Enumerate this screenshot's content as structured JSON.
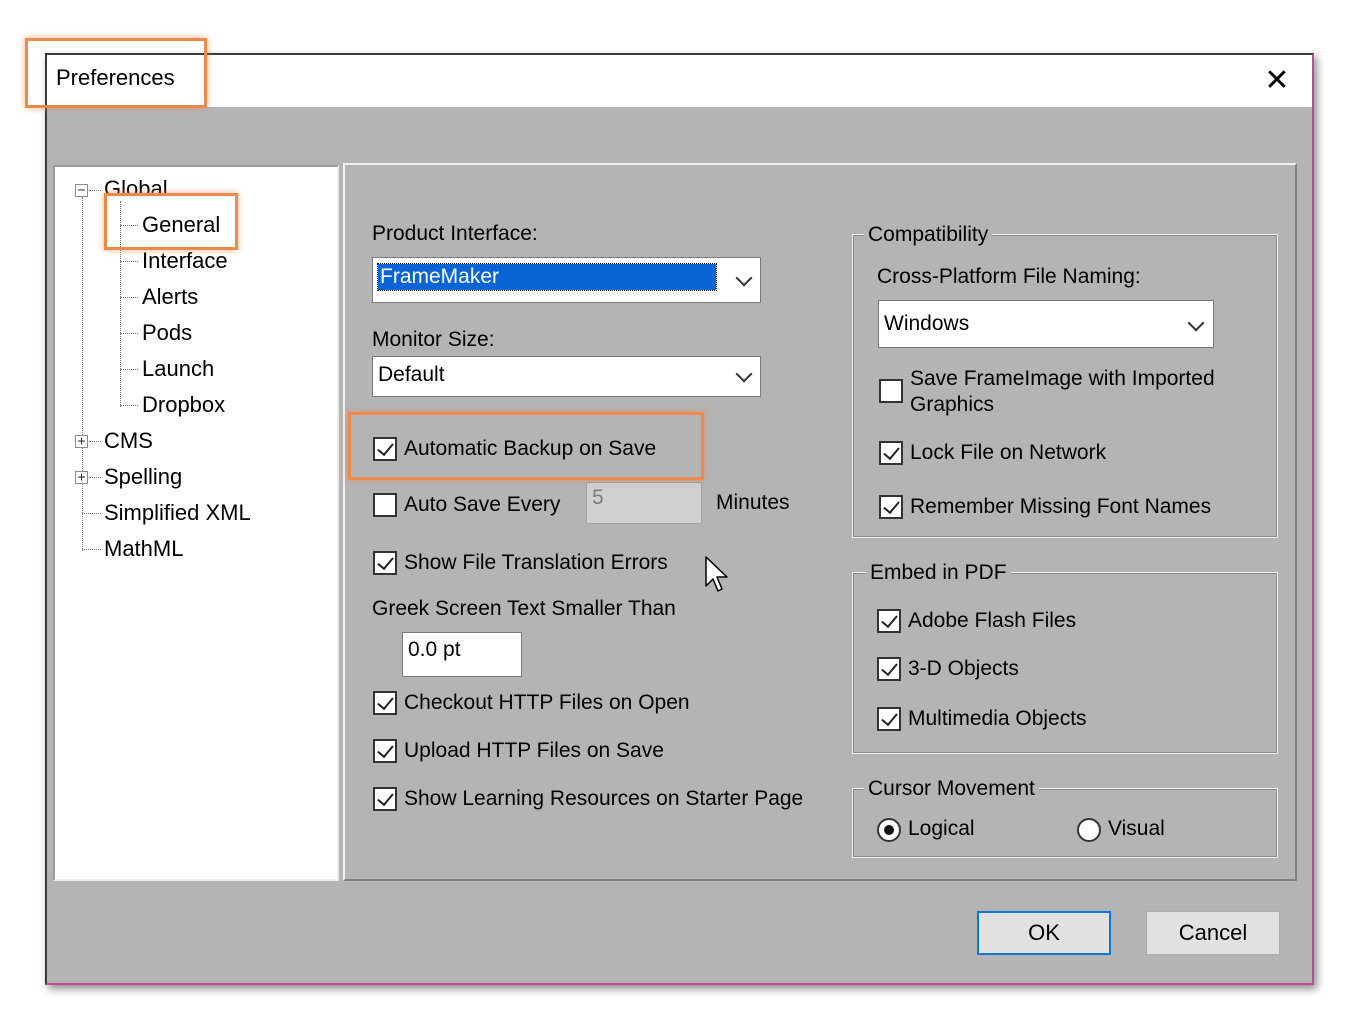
{
  "window": {
    "title": "Preferences",
    "close_glyph": "✕"
  },
  "tree": {
    "global": "Global",
    "children": [
      "General",
      "Interface",
      "Alerts",
      "Pods",
      "Launch",
      "Dropbox"
    ],
    "cms": "CMS",
    "spelling": "Spelling",
    "simplified_xml": "Simplified XML",
    "mathml": "MathML",
    "collapse_glyph": "−",
    "expand_glyph": "+"
  },
  "general": {
    "product_interface_label": "Product Interface:",
    "product_interface_value": "FrameMaker",
    "monitor_size_label": "Monitor Size:",
    "monitor_size_value": "Default",
    "automatic_backup_label": "Automatic Backup on Save",
    "automatic_backup_checked": true,
    "auto_save_label": "Auto Save Every",
    "auto_save_checked": false,
    "auto_save_value": "5",
    "minutes_label": "Minutes",
    "show_translation_errors_label": "Show File Translation Errors",
    "show_translation_errors_checked": true,
    "greek_label": "Greek Screen Text Smaller Than",
    "greek_value": "0.0 pt",
    "checkout_http_label": "Checkout HTTP Files on Open",
    "checkout_http_checked": true,
    "upload_http_label": "Upload HTTP Files on Save",
    "upload_http_checked": true,
    "learning_resources_label": "Show Learning Resources on Starter Page",
    "learning_resources_checked": true
  },
  "compatibility": {
    "legend": "Compatibility",
    "cross_platform_label": "Cross-Platform File Naming:",
    "cross_platform_value": "Windows",
    "save_frameimage_label_1": "Save FrameImage with Imported",
    "save_frameimage_label_2": "Graphics",
    "save_frameimage_checked": false,
    "lock_file_label": "Lock File on Network",
    "lock_file_checked": true,
    "remember_fonts_label": "Remember Missing Font Names",
    "remember_fonts_checked": true
  },
  "embed_pdf": {
    "legend": "Embed in PDF",
    "flash_label": "Adobe Flash Files",
    "flash_checked": true,
    "objects3d_label": "3-D Objects",
    "objects3d_checked": true,
    "multimedia_label": "Multimedia Objects",
    "multimedia_checked": true
  },
  "cursor_movement": {
    "legend": "Cursor Movement",
    "logical_label": "Logical",
    "visual_label": "Visual",
    "selected": "Logical"
  },
  "buttons": {
    "ok": "OK",
    "cancel": "Cancel"
  },
  "colors": {
    "highlight": "#ec8a4e",
    "selection": "#0a64d6",
    "dialog_bg": "#b4b4b4",
    "ok_border": "#0078d7"
  }
}
